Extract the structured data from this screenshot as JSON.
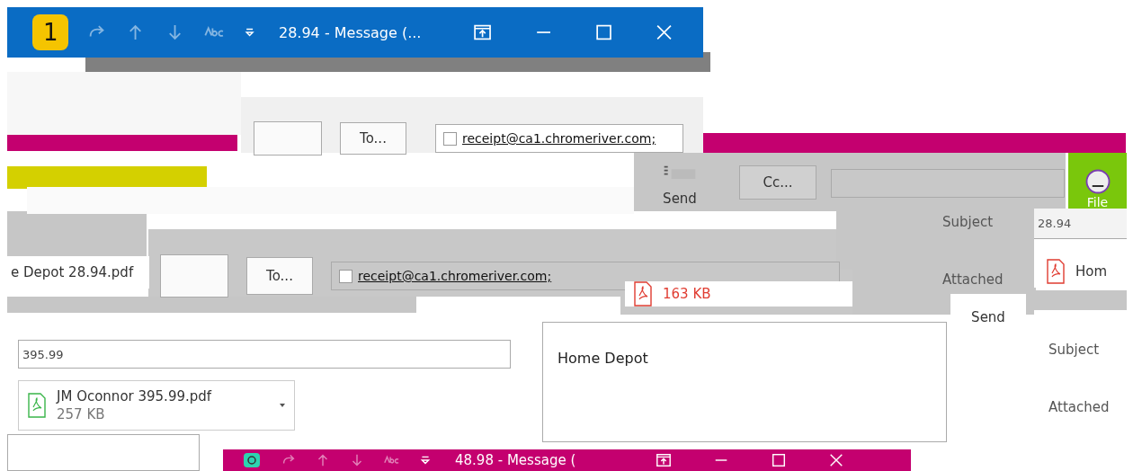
{
  "title_bars": [
    {
      "color": "#0a6cc4",
      "badge": "1",
      "title": "28.94 - Message (..."
    },
    {
      "color": "#c4006f",
      "title": "48.98 - Message ("
    }
  ],
  "recipient_rows": [
    {
      "button": "To...",
      "address": "receipt@ca1.chromeriver.com;"
    },
    {
      "button": "To...",
      "address": "receipt@ca1.chromeriver.com;"
    }
  ],
  "send_buttons": [
    "Send",
    "Send"
  ],
  "cc_button": "Cc...",
  "side_tab": "File",
  "subject_labels": [
    "Subject",
    "Subject"
  ],
  "attached_labels": [
    "Attached",
    "Attached"
  ],
  "subject_values": [
    "28.94",
    "395.99"
  ],
  "attachments": [
    {
      "name": "Hom"
    },
    {
      "name": "e Depot 28.94.pdf"
    },
    {
      "size": "163 KB"
    },
    {
      "name": "JM Oconnor 395.99.pdf",
      "size": "257 KB"
    }
  ],
  "body_text": "Home Depot"
}
